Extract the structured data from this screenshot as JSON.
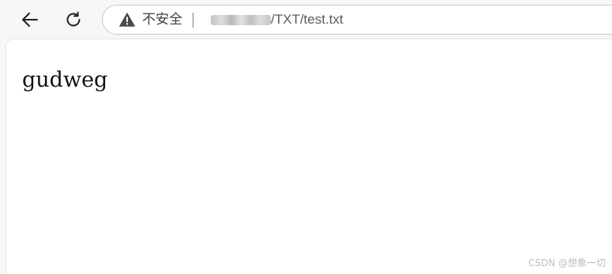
{
  "toolbar": {
    "back_icon": "arrow-left-icon",
    "reload_icon": "reload-icon"
  },
  "address_bar": {
    "security_icon": "warning-triangle-icon",
    "security_label": "不安全",
    "url_path": "/TXT/test.txt"
  },
  "page": {
    "text": "gudweg"
  },
  "watermark": {
    "text": "CSDN @想象一切"
  }
}
